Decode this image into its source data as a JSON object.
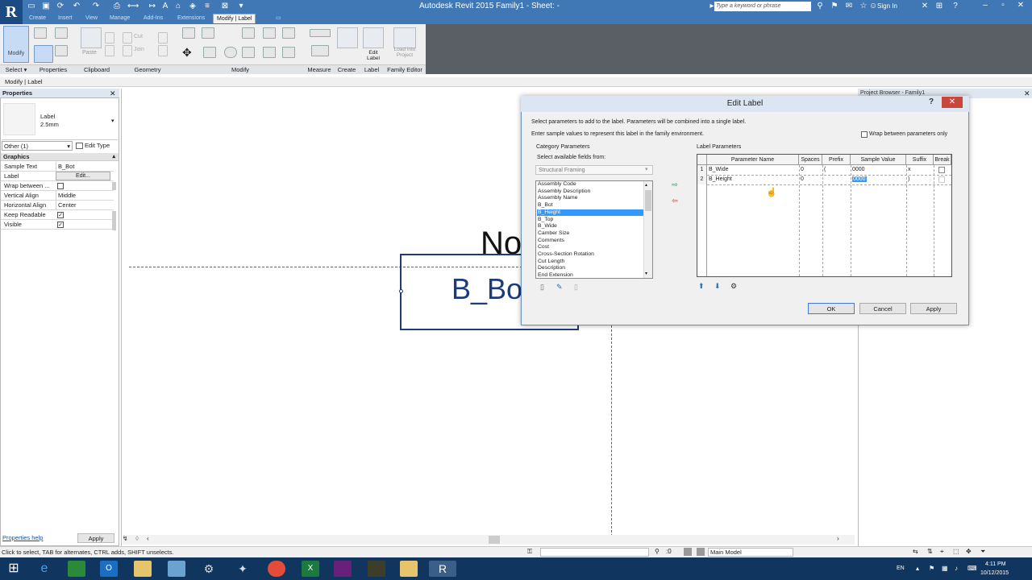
{
  "window": {
    "title": "Autodesk Revit 2015   Family1 - Sheet: -",
    "search_placeholder": "Type a keyword or phrase",
    "sign_in": "Sign In"
  },
  "tabs": [
    "Create",
    "Insert",
    "View",
    "Manage",
    "Add-Ins",
    "Extensions",
    "Modify | Label"
  ],
  "ribbon": {
    "modify": "Modify",
    "panels": [
      "Select ▾",
      "Properties",
      "Clipboard",
      "Geometry",
      "Modify",
      "Measure",
      "Create",
      "Label",
      "Family Editor"
    ],
    "buttons": {
      "paste": "Paste",
      "cut": "Cut",
      "join": "Join",
      "edit_label": "Edit Label",
      "load_into_project": "Load into Project"
    }
  },
  "context_bar": "Modify | Label",
  "properties": {
    "title": "Properties",
    "type_name": "Label",
    "type_size": "2.5mm",
    "filter": "Other (1)",
    "edit_type": "Edit Type",
    "group": "Graphics",
    "rows": [
      {
        "name": "Sample Text",
        "value": "B_Bot"
      },
      {
        "name": "Label",
        "value": "Edit..."
      },
      {
        "name": "Wrap between ...",
        "value": ""
      },
      {
        "name": "Vertical Align",
        "value": "Middle"
      },
      {
        "name": "Horizontal Align",
        "value": "Center"
      },
      {
        "name": "Keep Readable",
        "value": "✓"
      },
      {
        "name": "Visible",
        "value": "✓"
      }
    ],
    "help": "Properties help",
    "apply": "Apply"
  },
  "canvas": {
    "label_text": "B_Bot",
    "note_text": "No"
  },
  "project_browser": {
    "title": "Project Browser - Family1"
  },
  "dialog": {
    "title": "Edit Label",
    "help": "?",
    "instruction1": "Select parameters to add to the label.  Parameters will be combined into a single label.",
    "instruction2": "Enter sample values to represent this label in the family environment.",
    "wrap_option": "Wrap between parameters only",
    "category_group": "Category Parameters",
    "select_fields": "Select available fields from:",
    "category": "Structural Framing",
    "fields": [
      "Assembly Code",
      "Assembly Description",
      "Assembly Name",
      "B_Bot",
      "B_Height",
      "B_Top",
      "B_Wide",
      "Camber Size",
      "Comments",
      "Cost",
      "Cross-Section Rotation",
      "Cut Length",
      "Description",
      "End Extension"
    ],
    "selected_field": "B_Height",
    "label_params_title": "Label Parameters",
    "columns": [
      "Parameter Name",
      "Spaces",
      "Prefix",
      "Sample Value",
      "Suffix",
      "Break"
    ],
    "rows": [
      {
        "num": "1",
        "name": "B_Wide",
        "spaces": "0",
        "prefix": "(",
        "sample": "0000",
        "suffix": "x"
      },
      {
        "num": "2",
        "name": "B_Height",
        "spaces": "0",
        "prefix": "",
        "sample": "0000",
        "suffix": ")"
      }
    ],
    "ok": "OK",
    "cancel": "Cancel",
    "apply": "Apply"
  },
  "statusbar": {
    "hint": "Click to select, TAB for alternates, CTRL adds, SHIFT unselects.",
    "zero": ":0",
    "model": "Main Model"
  },
  "taskbar": {
    "lang": "EN",
    "time": "4:11 PM",
    "date": "10/12/2015"
  },
  "colors": {
    "titlebar": "#3f78b4",
    "taskbar": "#10355f",
    "label_blue": "#1c3b78",
    "selection": "#3399ff"
  }
}
